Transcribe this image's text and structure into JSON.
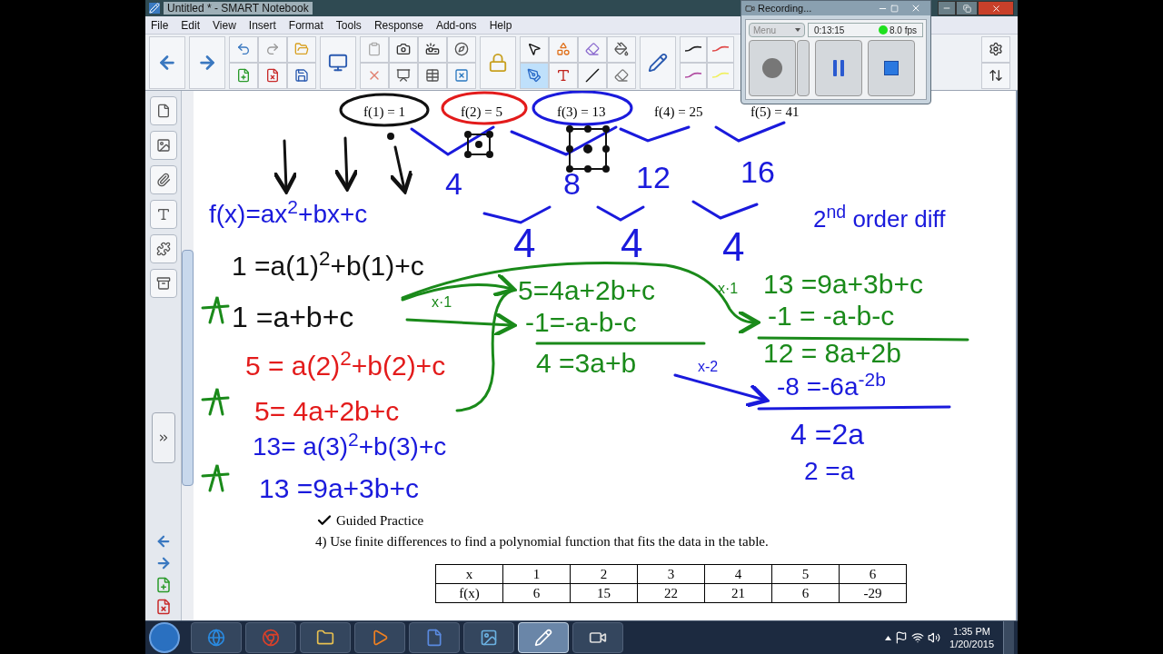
{
  "window": {
    "title": "Untitled * - SMART Notebook"
  },
  "menu": [
    "File",
    "Edit",
    "View",
    "Insert",
    "Format",
    "Tools",
    "Response",
    "Add-ons",
    "Help"
  ],
  "tools": [
    {
      "kind": "select",
      "selected": false
    },
    {
      "kind": "shapes",
      "selected": false
    },
    {
      "kind": "eraser-shape",
      "selected": false
    },
    {
      "kind": "fill",
      "selected": false
    },
    {
      "kind": "pens",
      "selected": true
    },
    {
      "kind": "text",
      "selected": false
    },
    {
      "kind": "line",
      "selected": false
    },
    {
      "kind": "eraser",
      "selected": false
    }
  ],
  "recorder": {
    "title": "Recording...",
    "menu": "Menu",
    "time": "0:13:15",
    "fps": "8.0 fps",
    "live": true
  },
  "page": {
    "labels": [
      "f(1) = 1",
      "f(2) = 5",
      "f(3) = 13",
      "f(4) = 25",
      "f(5) = 41"
    ],
    "ink": [
      {
        "text": "4",
        "color": "#1a1adc"
      },
      {
        "text": "8",
        "color": "#1a1adc"
      },
      {
        "text": "12",
        "color": "#1a1adc"
      },
      {
        "text": "16",
        "color": "#1a1adc"
      },
      {
        "text": "4",
        "color": "#1a1adc"
      },
      {
        "text": "4",
        "color": "#1a1adc"
      },
      {
        "text": "4",
        "color": "#1a1adc"
      },
      {
        "text": "f(x)=ax$^{2}$+bx+c",
        "color": "#1a1adc"
      },
      {
        "text": "2$^{nd}$ order diff",
        "color": "#1a1adc"
      },
      {
        "text": "1 =a(1)$^{2}$+b(1)+c",
        "color": "#111111"
      },
      {
        "text": "1 =a+b+c",
        "color": "#111111"
      },
      {
        "text": "5 = a(2)$^{2}$+b(2)+c",
        "color": "#e31b1b"
      },
      {
        "text": "5= 4a+2b+c",
        "color": "#e31b1b"
      },
      {
        "text": "13= a(3)$^{2}$+b(3)+c",
        "color": "#1a1adc"
      },
      {
        "text": "13 =9a+3b+c",
        "color": "#1a1adc"
      },
      {
        "text": "x·1",
        "color": "#1a8a1a"
      },
      {
        "text": "5=4a+2b+c",
        "color": "#1a8a1a"
      },
      {
        "text": "-1=-a-b-c",
        "color": "#1a8a1a"
      },
      {
        "text": "4 =3a+b",
        "color": "#1a8a1a"
      },
      {
        "text": "x·1",
        "color": "#1a8a1a"
      },
      {
        "text": "13 =9a+3b+c",
        "color": "#1a8a1a"
      },
      {
        "text": "-1 = -a-b-c",
        "color": "#1a8a1a"
      },
      {
        "text": "x-2",
        "color": "#1a1adc"
      },
      {
        "text": "12 = 8a+2b",
        "color": "#1a8a1a"
      },
      {
        "text": "-8 =-6a$^{-2b}$",
        "color": "#1a1adc"
      },
      {
        "text": "4 =2a",
        "color": "#1a1adc"
      },
      {
        "text": "2 =a",
        "color": "#1a1adc"
      }
    ],
    "heading": "Guided Practice",
    "question": "4)  Use finite differences to find a polynomial function that fits the data in the table.",
    "table": {
      "rows": [
        [
          "x",
          "1",
          "2",
          "3",
          "4",
          "5",
          "6"
        ],
        [
          "f(x)",
          "6",
          "15",
          "22",
          "21",
          "6",
          "-29"
        ]
      ]
    }
  },
  "taskbar": {
    "apps": [
      {
        "kind": "ie",
        "selected": false
      },
      {
        "kind": "chrome",
        "selected": false
      },
      {
        "kind": "explorer",
        "selected": false
      },
      {
        "kind": "media",
        "selected": false
      },
      {
        "kind": "word",
        "selected": false
      },
      {
        "kind": "photos",
        "selected": false
      },
      {
        "kind": "notebook",
        "selected": true
      },
      {
        "kind": "camera",
        "selected": false
      }
    ],
    "time": "1:35 PM",
    "date": "1/20/2015"
  }
}
